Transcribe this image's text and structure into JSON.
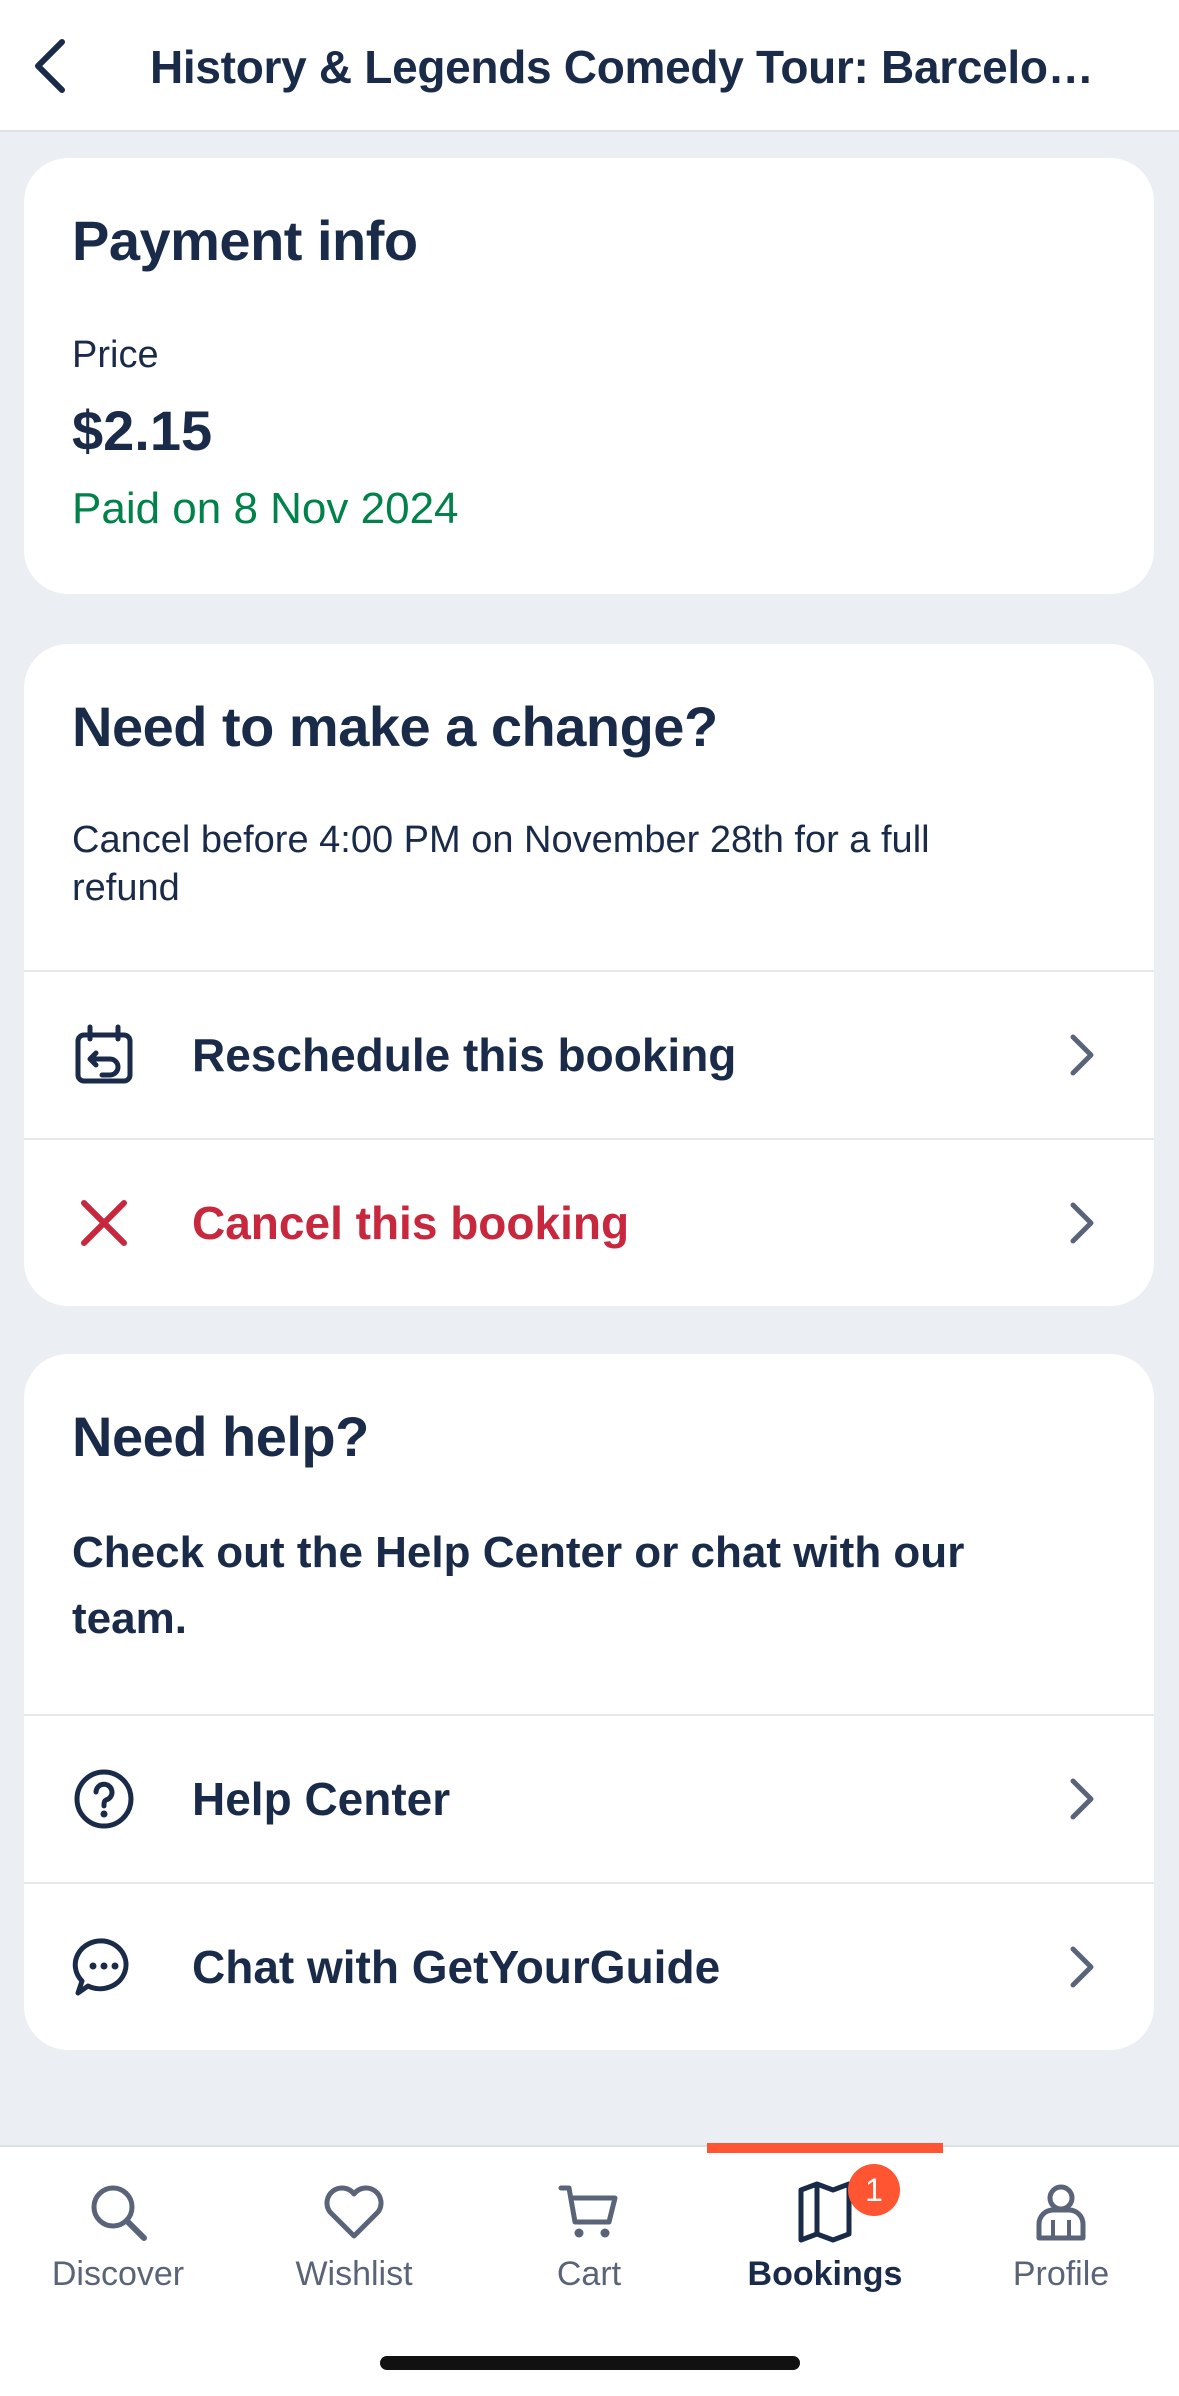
{
  "header": {
    "title": "History & Legends Comedy Tour: Barcelona..."
  },
  "payment": {
    "title": "Payment info",
    "price_label": "Price",
    "price": "$2.15",
    "paid_text": "Paid on 8 Nov 2024"
  },
  "change": {
    "title": "Need to make a change?",
    "description": "Cancel before 4:00 PM on November 28th for a full refund",
    "reschedule_label": "Reschedule this booking",
    "cancel_label": "Cancel this booking"
  },
  "help": {
    "title": "Need help?",
    "description": "Check out the Help Center or chat with our team.",
    "help_center_label": "Help Center",
    "chat_label": "Chat with GetYourGuide"
  },
  "tabs": [
    {
      "label": "Discover",
      "icon": "search-icon"
    },
    {
      "label": "Wishlist",
      "icon": "heart-icon"
    },
    {
      "label": "Cart",
      "icon": "cart-icon"
    },
    {
      "label": "Bookings",
      "icon": "bookings-icon",
      "active": true,
      "badge": "1"
    },
    {
      "label": "Profile",
      "icon": "profile-icon"
    }
  ],
  "colors": {
    "accent": "#ff5533",
    "text": "#1a2b49",
    "success": "#00824a",
    "danger": "#c8283e"
  }
}
